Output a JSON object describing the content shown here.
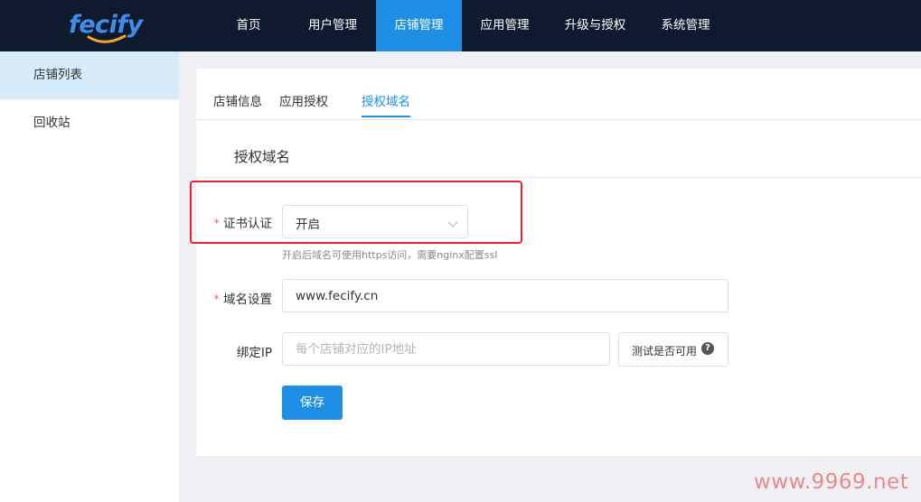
{
  "header": {
    "logo": "fecify",
    "nav": [
      {
        "label": "首页",
        "active": false
      },
      {
        "label": "用户管理",
        "active": false
      },
      {
        "label": "店铺管理",
        "active": true
      },
      {
        "label": "应用管理",
        "active": false
      },
      {
        "label": "升级与授权",
        "active": false
      },
      {
        "label": "系统管理",
        "active": false
      }
    ]
  },
  "sidebar": {
    "items": [
      {
        "label": "店铺列表",
        "active": true
      },
      {
        "label": "回收站",
        "active": false
      }
    ]
  },
  "tabs": [
    {
      "label": "店铺信息",
      "active": false
    },
    {
      "label": "应用授权",
      "active": false
    },
    {
      "label": "授权域名",
      "active": true
    }
  ],
  "section_title": "授权域名",
  "form": {
    "required_mark": "*",
    "cert": {
      "label": "证书认证",
      "value": "开启",
      "hint": "开启后域名可使用https访问，需要nginx配置ssl"
    },
    "domain": {
      "label": "域名设置",
      "value": "www.fecify.cn"
    },
    "ip": {
      "label": "绑定IP",
      "placeholder": "每个店铺对应的IP地址",
      "value": "",
      "test_label": "测试是否可用",
      "help_icon": "?"
    },
    "save_label": "保存"
  },
  "watermark": "www.9969.net",
  "colors": {
    "topbar": "#0e1a2e",
    "accent": "#1f8fe6",
    "highlight": "#e3242b",
    "required": "#f56c6c"
  },
  "icons": [
    "chevron-down-icon",
    "question-circle-icon"
  ]
}
